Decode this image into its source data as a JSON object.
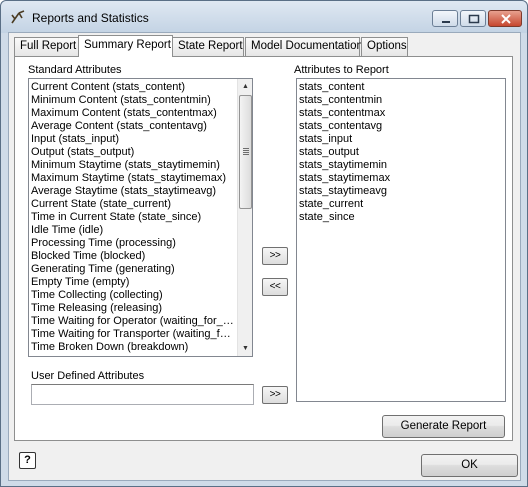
{
  "window": {
    "title": "Reports and Statistics",
    "buttons": {
      "ok": "OK",
      "help": "?"
    }
  },
  "tabs": [
    {
      "label": "Full Report"
    },
    {
      "label": "Summary Report"
    },
    {
      "label": "State Report"
    },
    {
      "label": "Model Documentation"
    },
    {
      "label": "Options"
    }
  ],
  "active_tab": "Summary Report",
  "standard_attributes": {
    "label": "Standard Attributes",
    "items": [
      "Current Content (stats_content)",
      "Minimum Content (stats_contentmin)",
      "Maximum Content (stats_contentmax)",
      "Average Content (stats_contentavg)",
      "Input (stats_input)",
      "Output (stats_output)",
      "Minimum Staytime (stats_staytimemin)",
      "Maximum Staytime (stats_staytimemax)",
      "Average Staytime (stats_staytimeavg)",
      "Current State (state_current)",
      "Time in Current State (state_since)",
      "Idle Time (idle)",
      "Processing Time (processing)",
      "Blocked Time (blocked)",
      "Generating Time (generating)",
      "Empty Time (empty)",
      "Time Collecting (collecting)",
      "Time Releasing (releasing)",
      "Time Waiting for Operator (waiting_for_operator)",
      "Time Waiting for Transporter (waiting_for_transporter)",
      "Time Broken Down (breakdown)"
    ]
  },
  "attributes_to_report": {
    "label": "Attributes to Report",
    "items": [
      "stats_content",
      "stats_contentmin",
      "stats_contentmax",
      "stats_contentavg",
      "stats_input",
      "stats_output",
      "stats_staytimemin",
      "stats_staytimemax",
      "stats_staytimeavg",
      "state_current",
      "state_since"
    ]
  },
  "user_defined": {
    "label": "User Defined Attributes",
    "value": ""
  },
  "move_buttons": {
    "add": ">>",
    "remove": "<<",
    "add_user": ">>"
  },
  "generate_button": "Generate Report"
}
